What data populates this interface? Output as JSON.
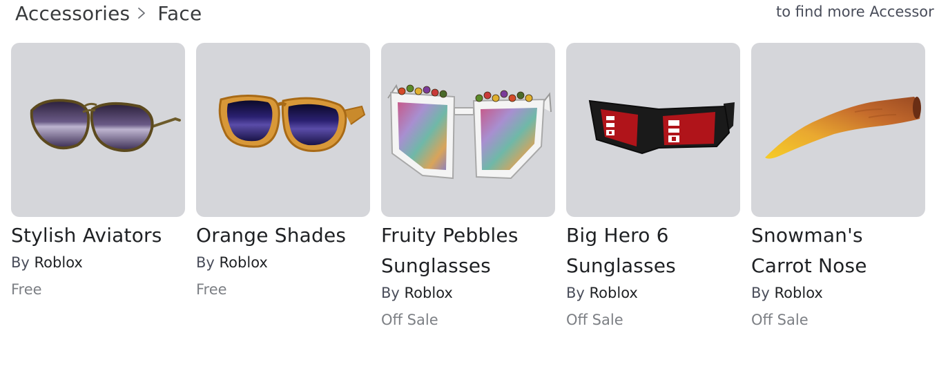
{
  "breadcrumb": {
    "parent": "Accessories",
    "separator_icon": "chevron-right-icon",
    "current": "Face"
  },
  "hint_text": "to find more Accessor",
  "items": [
    {
      "name": "Stylish Aviators",
      "by": "By",
      "creator": "Roblox",
      "price": "Free",
      "thumb_icon": "aviator-sunglasses"
    },
    {
      "name": "Orange Shades",
      "by": "By",
      "creator": "Roblox",
      "price": "Free",
      "thumb_icon": "orange-shades"
    },
    {
      "name": "Fruity Pebbles Sunglasses",
      "by": "By",
      "creator": "Roblox",
      "price": "Off Sale",
      "thumb_icon": "fruity-pebbles-glasses"
    },
    {
      "name": "Big Hero 6 Sunglasses",
      "by": "By",
      "creator": "Roblox",
      "price": "Off Sale",
      "thumb_icon": "big-hero-6-glasses"
    },
    {
      "name": "Snowman's Carrot Nose",
      "by": "By",
      "creator": "Roblox",
      "price": "Off Sale",
      "thumb_icon": "carrot-nose"
    }
  ],
  "colors": {
    "thumb_bg": "#d5d6da",
    "price_text": "#7c7f84",
    "title_text": "#1f2124"
  }
}
